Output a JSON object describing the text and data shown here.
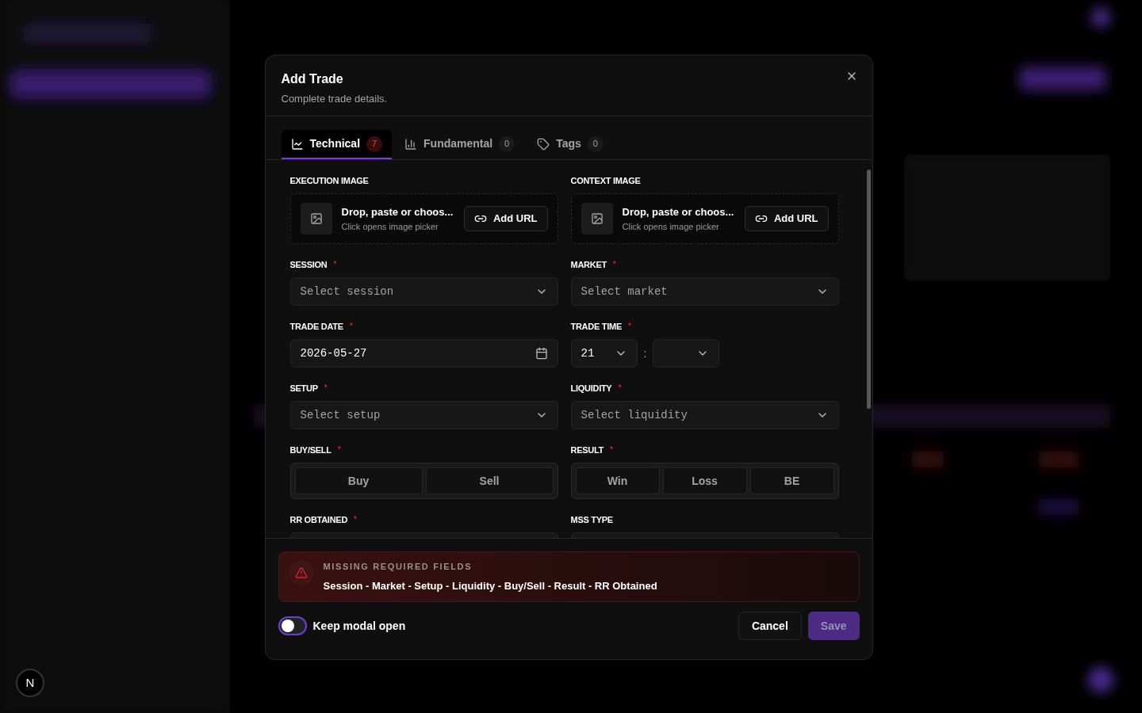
{
  "dialog": {
    "title": "Add Trade",
    "subtitle": "Complete trade details."
  },
  "required_mark": "*",
  "tabs": [
    {
      "label": "Technical",
      "count": "7",
      "selected": true,
      "alert": true
    },
    {
      "label": "Fundamental",
      "count": "0",
      "selected": false,
      "alert": false
    },
    {
      "label": "Tags",
      "count": "0",
      "selected": false,
      "alert": false
    }
  ],
  "fields": [
    {
      "kind": "image",
      "label": "EXECUTION IMAGE",
      "required": false,
      "title": "Drop, paste or choos...",
      "hint": "Click opens image picker",
      "button": "Add URL"
    },
    {
      "kind": "image",
      "label": "CONTEXT IMAGE",
      "required": false,
      "title": "Drop, paste or choos...",
      "hint": "Click opens image picker",
      "button": "Add URL"
    },
    {
      "kind": "select",
      "label": "SESSION",
      "required": true,
      "placeholder": "Select session"
    },
    {
      "kind": "select",
      "label": "MARKET",
      "required": true,
      "placeholder": "Select market"
    },
    {
      "kind": "date",
      "label": "TRADE DATE",
      "required": true,
      "value": "2026-05-27"
    },
    {
      "kind": "time",
      "label": "TRADE TIME",
      "required": true,
      "hour": "21",
      "separator": ":"
    },
    {
      "kind": "select",
      "label": "SETUP",
      "required": true,
      "placeholder": "Select setup"
    },
    {
      "kind": "select",
      "label": "LIQUIDITY",
      "required": true,
      "placeholder": "Select liquidity"
    },
    {
      "kind": "segmented",
      "label": "BUY/SELL",
      "required": true,
      "options": [
        "Buy",
        "Sell"
      ]
    },
    {
      "kind": "segmented",
      "label": "RESULT",
      "required": true,
      "options": [
        "Win",
        "Loss",
        "BE"
      ]
    },
    {
      "kind": "cut",
      "label": "RR OBTAINED",
      "required": true
    },
    {
      "kind": "cut",
      "label": "MSS TYPE",
      "required": false
    }
  ],
  "alert": {
    "title": "MISSING REQUIRED FIELDS",
    "message": "Session - Market - Setup - Liquidity - Buy/Sell - Result - RR Obtained"
  },
  "keep_open": {
    "label": "Keep modal open",
    "on": false
  },
  "buttons": {
    "cancel": "Cancel",
    "save": "Save",
    "save_disabled": true
  },
  "dev_badge": "N"
}
